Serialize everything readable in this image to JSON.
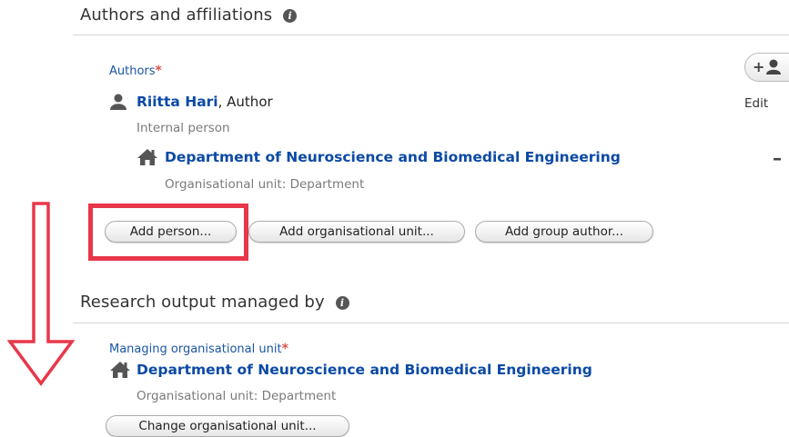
{
  "authors_section": {
    "title": "Authors and affiliations",
    "authors_label": "Authors",
    "required_mark": "*",
    "author": {
      "name": "Riitta Hari",
      "role_suffix": ", Author",
      "type": "Internal person",
      "edit_label": "Edit"
    },
    "affiliation": {
      "name": "Department of Neuroscience and Biomedical Engineering",
      "type": "Organisational unit: Department",
      "remove_label": "–"
    },
    "buttons": {
      "add_person": "Add person...",
      "add_org_unit": "Add organisational unit...",
      "add_group_author": "Add group author..."
    },
    "add_author_icon": "add-person-icon"
  },
  "managed_section": {
    "title": "Research output managed by",
    "managing_label": "Managing organisational unit",
    "required_mark": "*",
    "unit": {
      "name": "Department of Neuroscience and Biomedical Engineering",
      "type": "Organisational unit: Department"
    },
    "change_button": "Change organisational unit..."
  },
  "annotations": {
    "highlight_color": "#e8374a",
    "arrow_color": "#e8374a"
  }
}
